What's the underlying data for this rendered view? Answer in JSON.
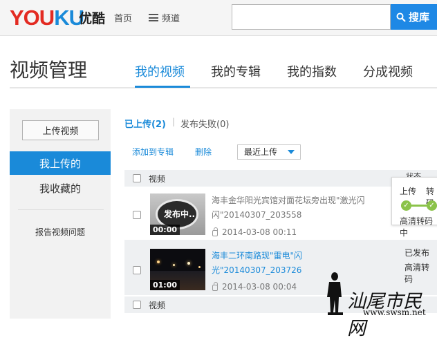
{
  "header": {
    "logo_text_red": "YOU",
    "logo_text_blue": "KU",
    "logo_cn": "优酷",
    "nav_home": "首页",
    "nav_channels": "频道",
    "search_placeholder": "",
    "search_button": "搜库"
  },
  "page": {
    "title": "视频管理",
    "tabs": [
      {
        "label": "我的视频",
        "active": true
      },
      {
        "label": "我的专辑",
        "active": false
      },
      {
        "label": "我的指数",
        "active": false
      },
      {
        "label": "分成视频",
        "active": false
      }
    ]
  },
  "sidebar": {
    "upload_button": "上传视频",
    "items": [
      {
        "label": "我上传的",
        "active": true
      },
      {
        "label": "我收藏的",
        "active": false
      }
    ],
    "report_link": "报告视频问题"
  },
  "subtabs": {
    "uploaded": "已上传(2)",
    "separator": "|",
    "failed": "发布失败(0)"
  },
  "actions": {
    "add_to_album": "添加到专辑",
    "delete": "删除",
    "sort_selected": "最近上传"
  },
  "table": {
    "header_video": "视频",
    "header_status": "状态",
    "footer_video": "视频",
    "rows": [
      {
        "thumb_label": "发布中..",
        "duration": "00:00",
        "title": "海丰金华阳光宾馆对面花坛旁出现\"激光闪闪\"20140307_203558",
        "date": "2014-03-08 00:11"
      },
      {
        "duration": "01:00",
        "title": "海丰二环南路现\"雷电\"闪光\"20140307_203726",
        "date": "2014-03-08 00:04",
        "status": "已发布",
        "status2": "高清转码"
      }
    ]
  },
  "popup": {
    "step_upload": "上传",
    "step_transcode": "转码",
    "status": "高清转码中"
  },
  "watermark": {
    "text": "汕尾市民网",
    "url": "www.swsm.net"
  },
  "colors": {
    "brand_blue": "#1a8ad9",
    "brand_red": "#e32b22",
    "progress_green": "#8bc34a"
  }
}
